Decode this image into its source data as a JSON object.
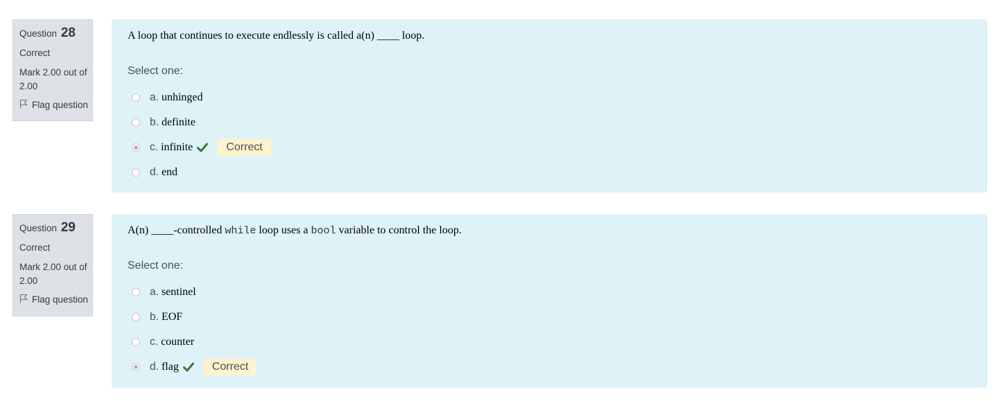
{
  "questions": [
    {
      "label": "Question",
      "number": "28",
      "state": "Correct",
      "grade": "Mark 2.00 out of 2.00",
      "flag_label": "Flag question",
      "text_parts": {
        "before": "A loop that continues to execute endlessly is called a(n) ____ loop."
      },
      "prompt": "Select one:",
      "options": [
        {
          "letter": "a.",
          "text": "unhinged",
          "selected": false
        },
        {
          "letter": "b.",
          "text": "definite",
          "selected": false
        },
        {
          "letter": "c.",
          "text": "infinite",
          "selected": true,
          "feedback": "Correct"
        },
        {
          "letter": "d.",
          "text": "end",
          "selected": false
        }
      ]
    },
    {
      "label": "Question",
      "number": "29",
      "state": "Correct",
      "grade": "Mark 2.00 out of 2.00",
      "flag_label": "Flag question",
      "text_parts": {
        "t1": "A(n) ____-controlled ",
        "code1": "while",
        "t2": " loop uses a ",
        "code2": "bool",
        "t3": " variable to control the loop."
      },
      "prompt": "Select one:",
      "options": [
        {
          "letter": "a.",
          "text": "sentinel",
          "selected": false
        },
        {
          "letter": "b.",
          "text": "EOF",
          "selected": false
        },
        {
          "letter": "c.",
          "text": "counter",
          "selected": false
        },
        {
          "letter": "d.",
          "text": "flag",
          "selected": true,
          "feedback": "Correct"
        }
      ]
    }
  ],
  "colors": {
    "info_bg": "#dee2e6",
    "content_bg": "#def2f8",
    "check": "#357a32",
    "feedback_bg": "#fff3cd"
  },
  "icons": {
    "flag": "flag-icon",
    "check": "check-icon"
  }
}
